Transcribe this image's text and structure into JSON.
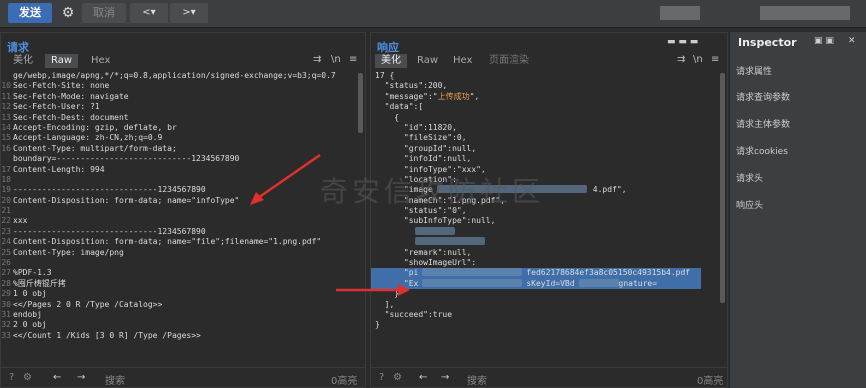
{
  "toolbar": {
    "send": "发送",
    "cancel": "取消",
    "back": "<▾",
    "fwd": ">▾"
  },
  "req": {
    "title": "请求",
    "tabs": [
      "美化",
      "Raw",
      "Hex"
    ],
    "lines": [
      [
        "",
        "ge/webp,image/apng,*/*;q=0.8,application/signed-exchange;v=b3;q=0.7"
      ],
      [
        "10",
        "Sec-Fetch-Site: none"
      ],
      [
        "11",
        "Sec-Fetch-Mode: navigate"
      ],
      [
        "12",
        "Sec-Fetch-User: ?1"
      ],
      [
        "13",
        "Sec-Fetch-Dest: document"
      ],
      [
        "14",
        "Accept-Encoding: gzip, deflate, br"
      ],
      [
        "15",
        "Accept-Language: zh-CN,zh;q=0.9"
      ],
      [
        "16",
        "Content-Type: multipart/form-data;"
      ],
      [
        "",
        "boundary=----------------------------1234567890"
      ],
      [
        "17",
        "Content-Length: 994"
      ],
      [
        "18",
        ""
      ],
      [
        "19",
        "------------------------------1234567890"
      ],
      [
        "20",
        "Content-Disposition: form-data; name=\"infoType\""
      ],
      [
        "21",
        ""
      ],
      [
        "22",
        "xxx"
      ],
      [
        "23",
        "------------------------------1234567890"
      ],
      [
        "24",
        "Content-Disposition: form-data; name=\"file\";filename=\"1.png.pdf\""
      ],
      [
        "25",
        "Content-Type: image/png"
      ],
      [
        "26",
        ""
      ],
      [
        "27",
        "%PDF-1.3"
      ],
      [
        "28",
        "%囤斤梼锟斤拷"
      ],
      [
        "29",
        "1 0 obj"
      ],
      [
        "30",
        "<</Pages 2 0 R /Type /Catalog>>"
      ],
      [
        "31",
        "endobj"
      ],
      [
        "32",
        "2 0 obj"
      ],
      [
        "33",
        "<</Count 1 /Kids [3 0 R] /Type /Pages>>"
      ]
    ],
    "search": "搜索",
    "matches": "0高亮"
  },
  "resp": {
    "title": "响应",
    "tabs": [
      "美化",
      "Raw",
      "Hex",
      "页面渲染"
    ],
    "lines": [
      "17 {",
      "  \"status\":200,",
      "  \"message\":\"上传成功\",",
      "  \"data\":[",
      "    {",
      "      \"id\":11820,",
      "      \"fileSize\":0,",
      "      \"groupId\":null,",
      "      \"infoId\":null,",
      "      \"infoType\":\"xxx\",",
      "      \"location\":",
      "      \"image",
      "      \"nameCh\":\"1.png.pdf\",",
      "      \"status\":\"0\",",
      "      \"subInfoType\":null,",
      "",
      "",
      "      \"remark\":null,",
      "      \"showImageUrl\":",
      "      \"pi",
      "      \"Ex",
      "    }",
      "  ],",
      "  \"succeed\":true",
      "}"
    ],
    "frag1": "4.pdf\",",
    "frag2": "fed62178684ef3a8c05150c49315b4.pdf",
    "frag3": "sKeyId=VBd",
    "frag4": "gnature=",
    "search": "搜索",
    "matches": "0高亮"
  },
  "inspector": {
    "title": "Inspector",
    "items": [
      "请求属性",
      "请求查询参数",
      "请求主体参数",
      "请求cookies",
      "请求头",
      "响应头"
    ]
  },
  "watermark": "奇安信攻防社区"
}
